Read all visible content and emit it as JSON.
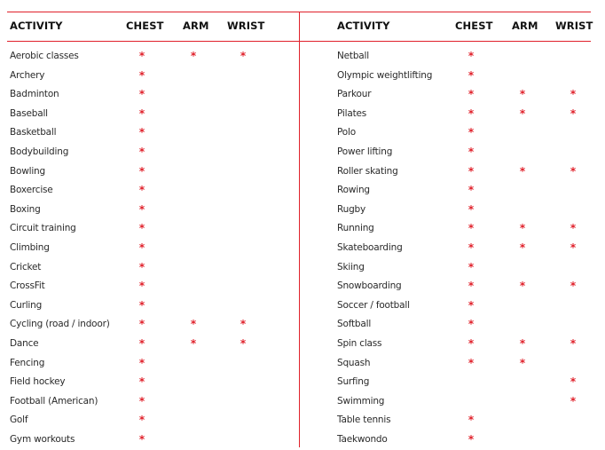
{
  "headers": {
    "activity": "ACTIVITY",
    "chest": "CHEST",
    "arm": "ARM",
    "wrist": "WRIST"
  },
  "mark_symbol": "*",
  "accent_color": "#e0202a",
  "left": [
    {
      "activity": "Aerobic classes",
      "chest": true,
      "arm": true,
      "wrist": true
    },
    {
      "activity": "Archery",
      "chest": true,
      "arm": false,
      "wrist": false
    },
    {
      "activity": "Badminton",
      "chest": true,
      "arm": false,
      "wrist": false
    },
    {
      "activity": "Baseball",
      "chest": true,
      "arm": false,
      "wrist": false
    },
    {
      "activity": "Basketball",
      "chest": true,
      "arm": false,
      "wrist": false
    },
    {
      "activity": "Bodybuilding",
      "chest": true,
      "arm": false,
      "wrist": false
    },
    {
      "activity": "Bowling",
      "chest": true,
      "arm": false,
      "wrist": false
    },
    {
      "activity": "Boxercise",
      "chest": true,
      "arm": false,
      "wrist": false
    },
    {
      "activity": "Boxing",
      "chest": true,
      "arm": false,
      "wrist": false
    },
    {
      "activity": "Circuit training",
      "chest": true,
      "arm": false,
      "wrist": false
    },
    {
      "activity": "Climbing",
      "chest": true,
      "arm": false,
      "wrist": false
    },
    {
      "activity": "Cricket",
      "chest": true,
      "arm": false,
      "wrist": false
    },
    {
      "activity": "CrossFit",
      "chest": true,
      "arm": false,
      "wrist": false
    },
    {
      "activity": "Curling",
      "chest": true,
      "arm": false,
      "wrist": false
    },
    {
      "activity": "Cycling (road / indoor)",
      "chest": true,
      "arm": true,
      "wrist": true
    },
    {
      "activity": "Dance",
      "chest": true,
      "arm": true,
      "wrist": true
    },
    {
      "activity": "Fencing",
      "chest": true,
      "arm": false,
      "wrist": false
    },
    {
      "activity": "Field hockey",
      "chest": true,
      "arm": false,
      "wrist": false
    },
    {
      "activity": "Football (American)",
      "chest": true,
      "arm": false,
      "wrist": false
    },
    {
      "activity": "Golf",
      "chest": true,
      "arm": false,
      "wrist": false
    },
    {
      "activity": "Gym workouts",
      "chest": true,
      "arm": false,
      "wrist": false
    }
  ],
  "right": [
    {
      "activity": "Netball",
      "chest": true,
      "arm": false,
      "wrist": false
    },
    {
      "activity": "Olympic weightlifting",
      "chest": true,
      "arm": false,
      "wrist": false
    },
    {
      "activity": "Parkour",
      "chest": true,
      "arm": true,
      "wrist": true
    },
    {
      "activity": "Pilates",
      "chest": true,
      "arm": true,
      "wrist": true
    },
    {
      "activity": "Polo",
      "chest": true,
      "arm": false,
      "wrist": false
    },
    {
      "activity": "Power lifting",
      "chest": true,
      "arm": false,
      "wrist": false
    },
    {
      "activity": "Roller skating",
      "chest": true,
      "arm": true,
      "wrist": true
    },
    {
      "activity": "Rowing",
      "chest": true,
      "arm": false,
      "wrist": false
    },
    {
      "activity": "Rugby",
      "chest": true,
      "arm": false,
      "wrist": false
    },
    {
      "activity": "Running",
      "chest": true,
      "arm": true,
      "wrist": true
    },
    {
      "activity": "Skateboarding",
      "chest": true,
      "arm": true,
      "wrist": true
    },
    {
      "activity": "Skiing",
      "chest": true,
      "arm": false,
      "wrist": false
    },
    {
      "activity": "Snowboarding",
      "chest": true,
      "arm": true,
      "wrist": true
    },
    {
      "activity": "Soccer / football",
      "chest": true,
      "arm": false,
      "wrist": false
    },
    {
      "activity": "Softball",
      "chest": true,
      "arm": false,
      "wrist": false
    },
    {
      "activity": "Spin class",
      "chest": true,
      "arm": true,
      "wrist": true
    },
    {
      "activity": "Squash",
      "chest": true,
      "arm": true,
      "wrist": false
    },
    {
      "activity": "Surfing",
      "chest": false,
      "arm": false,
      "wrist": true
    },
    {
      "activity": "Swimming",
      "chest": false,
      "arm": false,
      "wrist": true
    },
    {
      "activity": "Table tennis",
      "chest": true,
      "arm": false,
      "wrist": false
    },
    {
      "activity": "Taekwondo",
      "chest": true,
      "arm": false,
      "wrist": false
    }
  ]
}
